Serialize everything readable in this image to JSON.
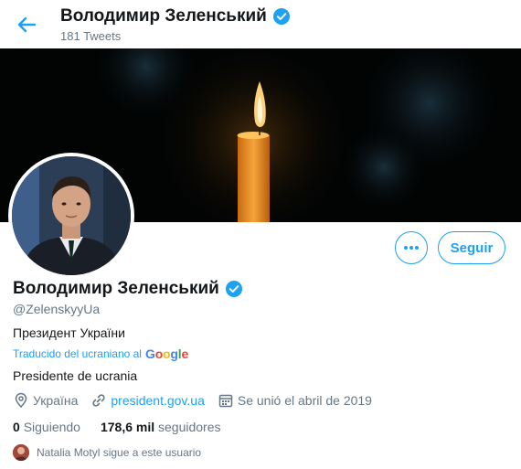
{
  "header": {
    "title": "Володимир Зеленський",
    "tweet_count": "181 Tweets"
  },
  "profile": {
    "name": "Володимир Зеленський",
    "handle": "@ZelenskyyUa",
    "bio": "Президент України",
    "translated_label": "Traducido del ucraniano al",
    "translator_brand": "Google",
    "bio_translated": "Presidente de ucrania",
    "location": "Україна",
    "website": "president.gov.ua",
    "joined": "Se unió el abril de 2019"
  },
  "actions": {
    "follow_label": "Seguir"
  },
  "stats": {
    "following_count": "0",
    "following_label": "Siguiendo",
    "followers_count": "178,6 mil",
    "followers_label": "seguidores"
  },
  "followers_you_know": "Natalia Motyl sigue a este usuario",
  "colors": {
    "accent": "#1da1f2",
    "text": "#14171a",
    "secondary": "#657786"
  }
}
